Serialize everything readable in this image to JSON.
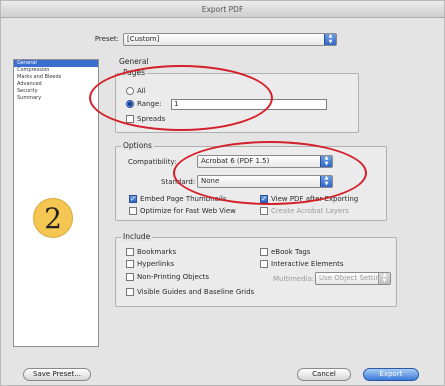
{
  "window": {
    "title": "Export PDF"
  },
  "preset": {
    "label": "Preset:",
    "value": "[Custom]"
  },
  "sidebar": {
    "items": [
      {
        "label": "General",
        "selected": true
      },
      {
        "label": "Compression",
        "selected": false
      },
      {
        "label": "Marks and Bleeds",
        "selected": false
      },
      {
        "label": "Advanced",
        "selected": false
      },
      {
        "label": "Security",
        "selected": false
      },
      {
        "label": "Summary",
        "selected": false
      }
    ]
  },
  "panel": {
    "title": "General"
  },
  "pages": {
    "title": "Pages",
    "all_label": "All",
    "range_label": "Range:",
    "range_value": "1",
    "spreads_label": "Spreads",
    "selected": "range"
  },
  "options": {
    "title": "Options",
    "compatibility_label": "Compatibility:",
    "compatibility_value": "Acrobat 6 (PDF 1.5)",
    "standard_label": "Standard:",
    "standard_value": "None",
    "embed_thumbnails_label": "Embed Page Thumbnails",
    "view_after_label": "View PDF after Exporting",
    "optimize_label": "Optimize for Fast Web View",
    "create_layers_label": "Create Acrobat Layers"
  },
  "include": {
    "title": "Include",
    "bookmarks_label": "Bookmarks",
    "ebook_tags_label": "eBook Tags",
    "hyperlinks_label": "Hyperlinks",
    "interactive_label": "Interactive Elements",
    "nonprinting_label": "Non-Printing Objects",
    "multimedia_label": "Multimedia:",
    "multimedia_value": "Use Object Settings",
    "guides_label": "Visible Guides and Baseline Grids"
  },
  "badge": {
    "step": "2"
  },
  "buttons": {
    "save_preset": "Save Preset...",
    "cancel": "Cancel",
    "export": "Export"
  },
  "colors": {
    "accent": "#3a6fcf",
    "annotation": "#d4202a",
    "badge": "#f5c752"
  }
}
